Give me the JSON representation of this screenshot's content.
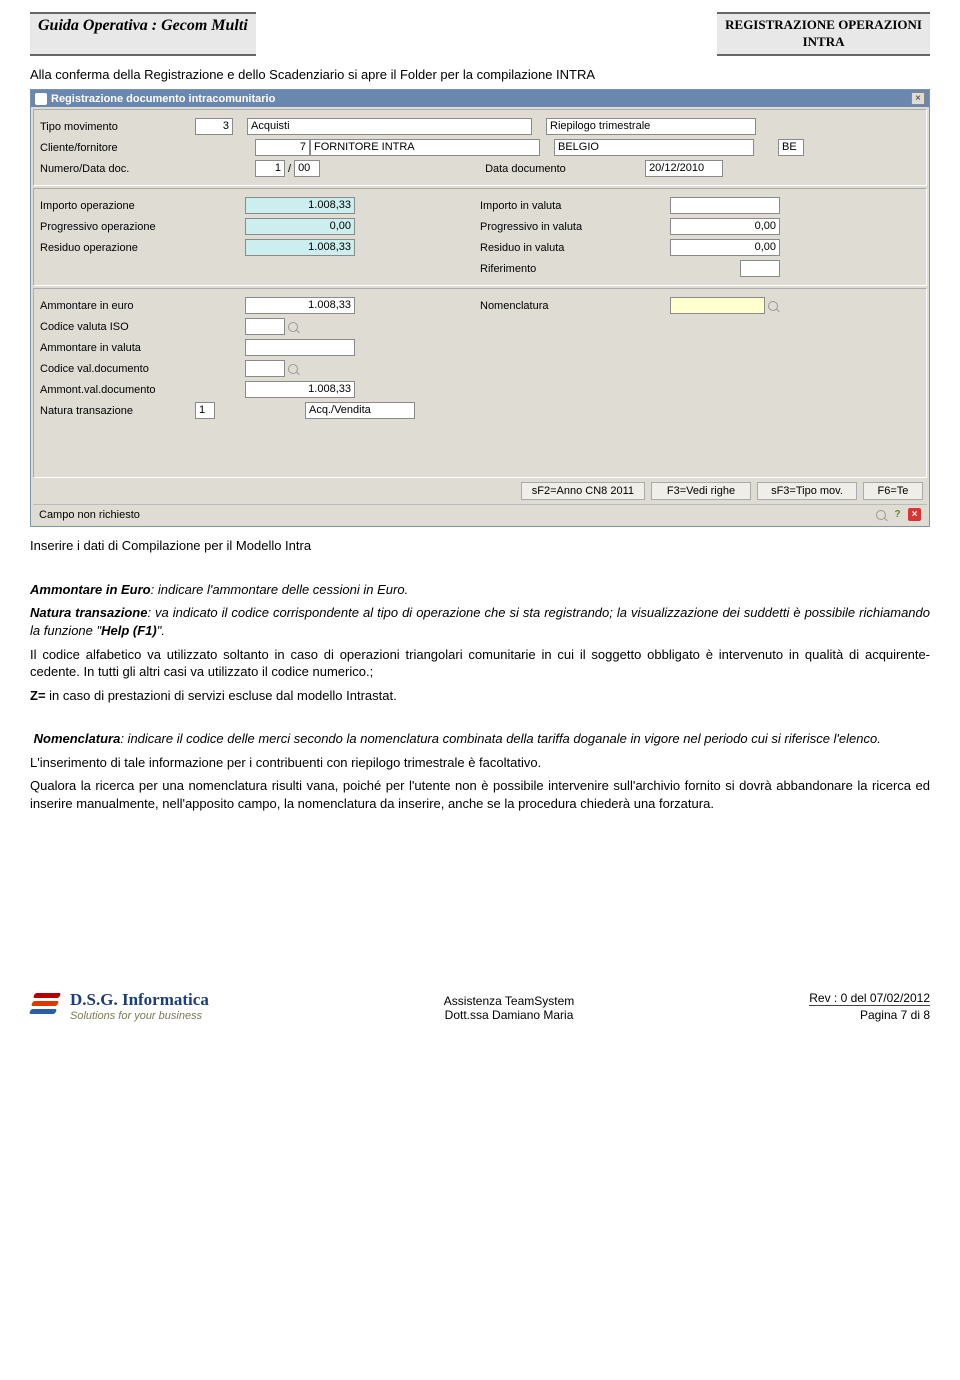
{
  "header": {
    "left": "Guida Operativa : Gecom Multi",
    "right_l1": "REGISTRAZIONE OPERAZIONI",
    "right_l2": "INTRA"
  },
  "intro1": "Alla conferma della Registrazione e dello Scadenziario si apre il Folder per la compilazione INTRA",
  "win": {
    "title": "Registrazione documento intracomunitario",
    "p1": {
      "lbl_tipo_mov": "Tipo movimento",
      "tipo_mov_code": "3",
      "tipo_mov_desc": "Acquisti",
      "riepilogo": "Riepilogo trimestrale",
      "lbl_clifor": "Cliente/fornitore",
      "clifor_code": "7",
      "clifor_desc": "FORNITORE INTRA",
      "paese": "BELGIO",
      "iso": "BE",
      "lbl_numdata": "Numero/Data doc.",
      "num": "1",
      "anno": "00",
      "lbl_datadoc": "Data documento",
      "datadoc": "20/12/2010"
    },
    "p2": {
      "lbl_impop": "Importo operazione",
      "impop": "1.008,33",
      "lbl_progop": "Progressivo operazione",
      "progop": "0,00",
      "lbl_resop": "Residuo operazione",
      "resop": "1.008,33",
      "lbl_impval": "Importo in valuta",
      "impval": "",
      "lbl_progval": "Progressivo in valuta",
      "progval": "0,00",
      "lbl_resval": "Residuo in valuta",
      "resval": "0,00",
      "lbl_rif": "Riferimento",
      "rif": ""
    },
    "p3": {
      "lbl_ammEuro": "Ammontare in euro",
      "ammEuro": "1.008,33",
      "lbl_codIso": "Codice valuta ISO",
      "codIso": "",
      "lbl_ammVal": "Ammontare in valuta",
      "ammVal": "",
      "lbl_codValDoc": "Codice val.documento",
      "codValDoc": "",
      "lbl_ammValDoc": "Ammont.val.documento",
      "ammValDoc": "1.008,33",
      "lbl_natura": "Natura transazione",
      "natura_code": "1",
      "natura_desc": "Acq./Vendita",
      "lbl_nomen": "Nomenclatura",
      "nomen": ""
    },
    "buttons": {
      "b1": "sF2=Anno CN8 2011",
      "b2": "F3=Vedi righe",
      "b3": "sF3=Tipo mov.",
      "b4": "F6=Te"
    },
    "status": "Campo non richiesto"
  },
  "aftershot": "Inserire i dati di Compilazione per il Modello Intra",
  "body": {
    "ammEuro_lbl": "Ammontare in Euro",
    "ammEuro_txt": ": indicare l'ammontare delle cessioni in Euro.",
    "natura_lbl": "Natura transazione",
    "natura_txt1": ": va indicato il codice corrispondente al tipo di operazione che si sta registrando; la visualizzazione dei suddetti è possibile richiamando la funzione \"",
    "natura_help": "Help (F1)",
    "natura_txt2": "\".",
    "p3": "Il codice alfabetico va utilizzato soltanto in caso di operazioni triangolari comunitarie in cui il soggetto obbligato è intervenuto in qualità di acquirente-cedente. In tutti gli altri casi va utilizzato il codice numerico.;",
    "p4_z": "Z=",
    "p4": "  in caso di prestazioni di servizi escluse dal modello Intrastat.",
    "nomen_lbl": "Nomenclatura",
    "nomen_txt": ": indicare il codice delle merci secondo la nomenclatura combinata della tariffa doganale in vigore nel periodo cui si riferisce l'elenco.",
    "p6": "L'inserimento di tale informazione per i contribuenti con riepilogo trimestrale è facoltativo.",
    "p7": "Qualora la ricerca per una nomenclatura risulti vana, poiché per l'utente non è possibile intervenire sull'archivio fornito si dovrà abbandonare la ricerca ed inserire manualmente, nell'apposito campo, la nomenclatura da inserire, anche se la procedura chiederà una forzatura."
  },
  "footer": {
    "logo1": "D.S.G. Informatica",
    "logo2": "Solutions for your business",
    "center1": "Assistenza TeamSystem",
    "center2": "Dott.ssa Damiano Maria",
    "rev": "Rev : 0 del 07/02/2012",
    "page": "Pagina 7 di 8"
  }
}
